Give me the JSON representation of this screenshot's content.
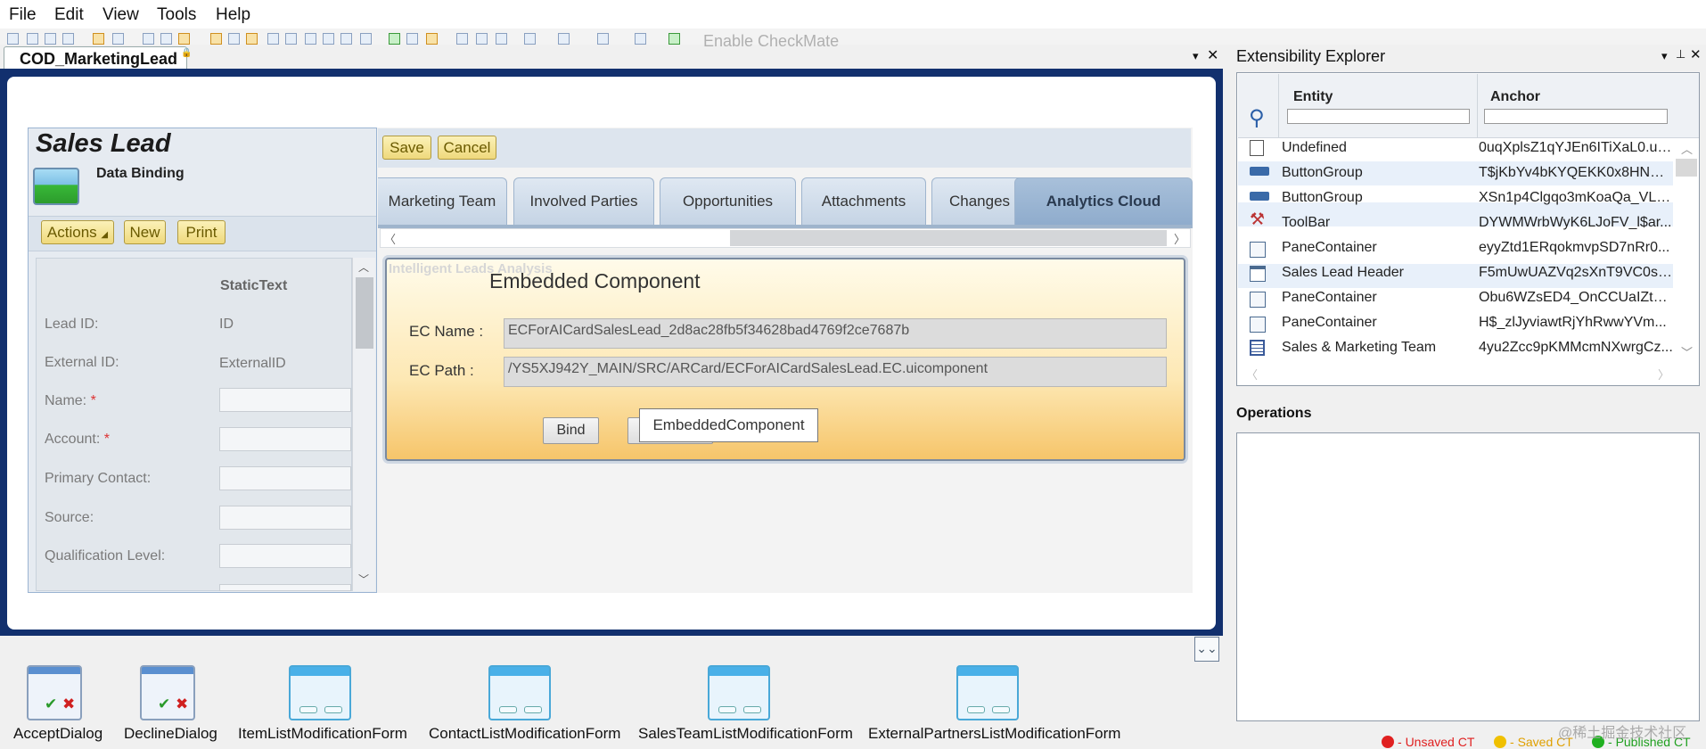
{
  "menu": [
    "File",
    "Edit",
    "View",
    "Tools",
    "Help"
  ],
  "toolbar": {
    "enable_checkmate": "Enable CheckMate"
  },
  "document_tab": {
    "title": "COD_MarketingLead"
  },
  "sales_lead": {
    "title": "Sales Lead",
    "subtitle": "Data Binding",
    "actions": [
      "Actions",
      "New",
      "Print"
    ],
    "column_header": "StaticText",
    "fields": [
      {
        "label": "Lead ID:",
        "value": "ID",
        "required": false
      },
      {
        "label": "External ID:",
        "value": "ExternalID",
        "required": false
      },
      {
        "label": "Name:",
        "value": "",
        "required": true
      },
      {
        "label": "Account:",
        "value": "",
        "required": true
      },
      {
        "label": "Primary Contact:",
        "value": "",
        "required": false
      },
      {
        "label": "Source:",
        "value": "",
        "required": false
      },
      {
        "label": "Qualification Level:",
        "value": "",
        "required": false
      }
    ],
    "required_marker": "*"
  },
  "save_bar": {
    "save": "Save",
    "cancel": "Cancel"
  },
  "tabs": [
    "Marketing Team",
    "Involved Parties",
    "Opportunities",
    "Attachments",
    "Changes",
    "Analytics Cloud"
  ],
  "active_tab": "Analytics Cloud",
  "ghost_title": "Intelligent Leads Analysis",
  "embedded_component": {
    "title": "Embedded Component",
    "ec_name_label": "EC Name :",
    "ec_name": "ECForAICardSalesLead_2d8ac28fb5f34628bad4769f2ce7687b",
    "ec_path_label": "EC Path :",
    "ec_path": "/YS5XJ942Y_MAIN/SRC/ARCard/ECForAICardSalesLead.EC.uicomponent",
    "bind_button": "Bind",
    "tooltip": "EmbeddedComponent"
  },
  "templates": [
    {
      "label": "AcceptDialog",
      "icon": "accept-dialog-icon"
    },
    {
      "label": "DeclineDialog",
      "icon": "decline-dialog-icon"
    },
    {
      "label": "ItemListModificationForm",
      "icon": "form-icon"
    },
    {
      "label": "ContactListModificationForm",
      "icon": "form-icon"
    },
    {
      "label": "SalesTeamListModificationForm",
      "icon": "form-icon"
    },
    {
      "label": "ExternalPartnersListModificationForm",
      "icon": "form-icon"
    }
  ],
  "extensibility_explorer": {
    "title": "Extensibility Explorer",
    "columns": [
      "Entity",
      "Anchor"
    ],
    "rows": [
      {
        "entity": "Undefined",
        "anchor": "0uqXplsZ1qYJEn6ITiXaL0.uia...",
        "icon": "document-icon"
      },
      {
        "entity": "ButtonGroup",
        "anchor": "T$jKbYv4bKYQEKK0x8HNXW...",
        "icon": "button-group-icon"
      },
      {
        "entity": "ButtonGroup",
        "anchor": "XSn1p4Clgqo3mKoaQa_VLn...",
        "icon": "button-group-icon"
      },
      {
        "entity": "ToolBar",
        "anchor": "DYWMWrbWyK6LJoFV_l$ar...",
        "icon": "toolbar-icon"
      },
      {
        "entity": "PaneContainer",
        "anchor": "eyyZtd1ERqokmvpSD7nRr0...",
        "icon": "pane-container-icon"
      },
      {
        "entity": "Sales Lead Header",
        "anchor": "F5mUwUAZVq2sXnT9VC0sC...",
        "icon": "header-icon"
      },
      {
        "entity": "PaneContainer",
        "anchor": "Obu6WZsED4_OnCCUaIZtR(...",
        "icon": "pane-container-icon"
      },
      {
        "entity": "PaneContainer",
        "anchor": "H$_zlJyviawtRjYhRwwYVm...",
        "icon": "pane-container-icon"
      },
      {
        "entity": "Sales & Marketing Team",
        "anchor": "4yu2Zcc9pKMMcmNXwrgCz...",
        "icon": "list-icon"
      }
    ]
  },
  "operations": {
    "title": "Operations"
  },
  "legend": [
    {
      "label": "Unsaved CT",
      "color": "#e02020"
    },
    {
      "label": "Saved CT",
      "color": "#f0c000"
    },
    {
      "label": "Published CT",
      "color": "#20b020"
    }
  ],
  "watermark": "@稀土掘金技术社区"
}
